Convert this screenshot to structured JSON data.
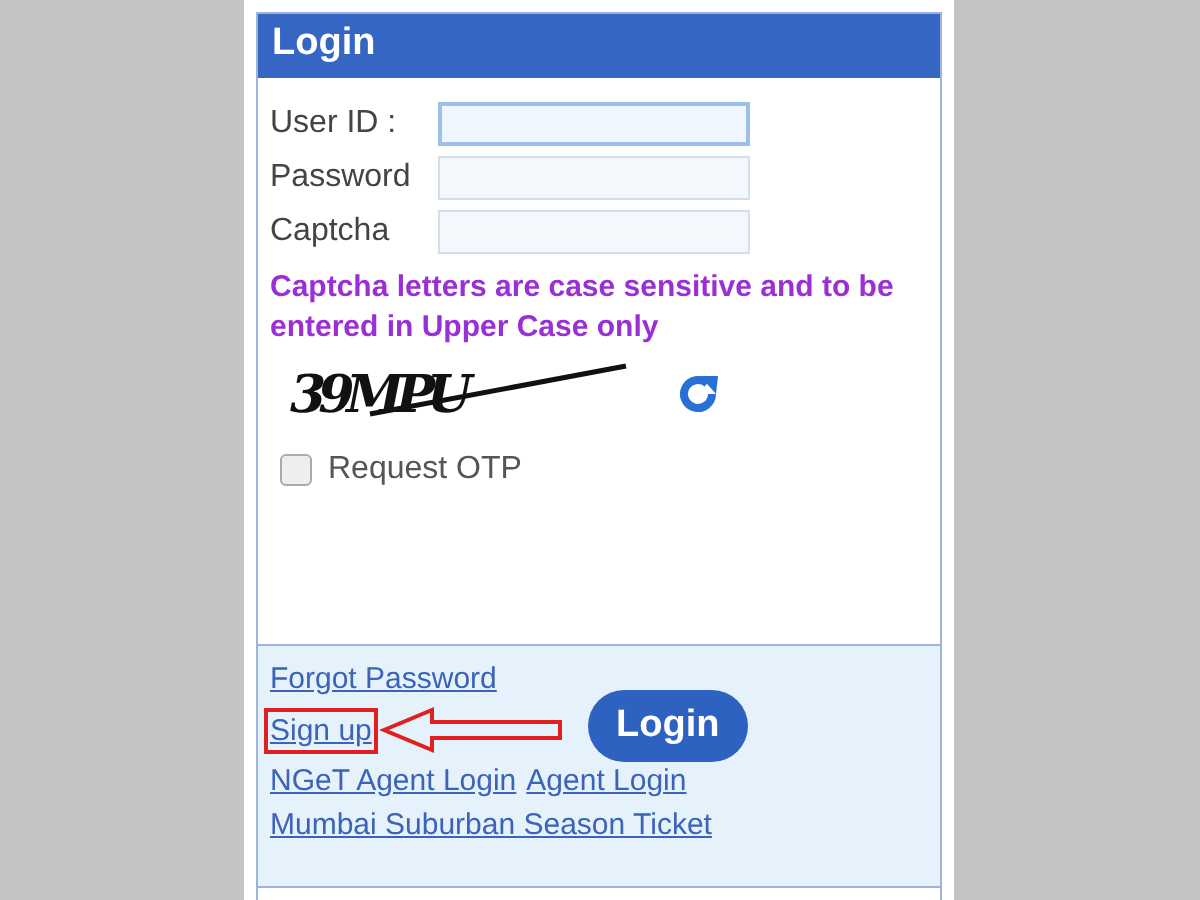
{
  "panel": {
    "title": "Login"
  },
  "fields": [
    {
      "label": "User ID :",
      "focused": true
    },
    {
      "label": "Password",
      "focused": false
    },
    {
      "label": "Captcha",
      "focused": false
    }
  ],
  "note": "Captcha letters are case sensitive and to be entered in Upper Case only",
  "captcha": {
    "text": "39MPU"
  },
  "otp": {
    "label": "Request OTP",
    "checked": false
  },
  "links": [
    {
      "label": "Forgot Password"
    },
    {
      "label": "Sign up",
      "highlighted": true
    },
    {
      "label": "NGeT Agent Login"
    },
    {
      "label": "Agent Login"
    },
    {
      "label": "Mumbai Suburban Season Ticket"
    }
  ],
  "login_button": "Login"
}
